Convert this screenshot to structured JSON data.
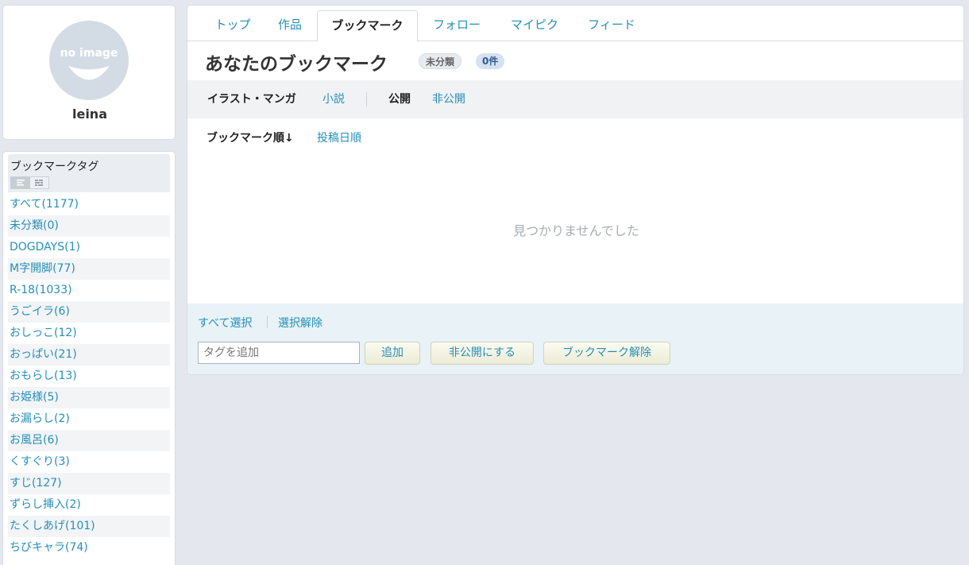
{
  "profile": {
    "avatar_text": "no image",
    "username": "leina"
  },
  "tag_panel": {
    "title": "ブックマークタグ",
    "tags": [
      "すべて(1177)",
      "未分類(0)",
      "DOGDAYS(1)",
      "M字開脚(77)",
      "R-18(1033)",
      "うごイラ(6)",
      "おしっこ(12)",
      "おっぱい(21)",
      "おもらし(13)",
      "お姫様(5)",
      "お漏らし(2)",
      "お風呂(6)",
      "くすぐり(3)",
      "すじ(127)",
      "ずらし挿入(2)",
      "たくしあげ(101)",
      "ちびキャラ(74)"
    ]
  },
  "tabs": [
    "トップ",
    "作品",
    "ブックマーク",
    "フォロー",
    "マイピク",
    "フィード"
  ],
  "active_tab": "ブックマーク",
  "header": {
    "title": "あなたのブックマーク",
    "badge_tag": "未分類",
    "badge_count": "0件"
  },
  "filters": {
    "type_selected": "イラスト・マンガ",
    "type_other": "小説",
    "visibility_selected": "公開",
    "visibility_other": "非公開"
  },
  "sort": {
    "current": "ブックマーク順↓",
    "other": "投稿日順"
  },
  "empty_message": "見つかりませんでした",
  "actions": {
    "select_all": "すべて選択",
    "deselect": "選択解除",
    "tag_placeholder": "タグを追加",
    "add_button": "追加",
    "private_button": "非公開にする",
    "remove_button": "ブックマーク解除"
  },
  "colors": {
    "link": "#258fb8",
    "background": "#e4e8ee",
    "bottom_bar": "#e8f2f7"
  }
}
